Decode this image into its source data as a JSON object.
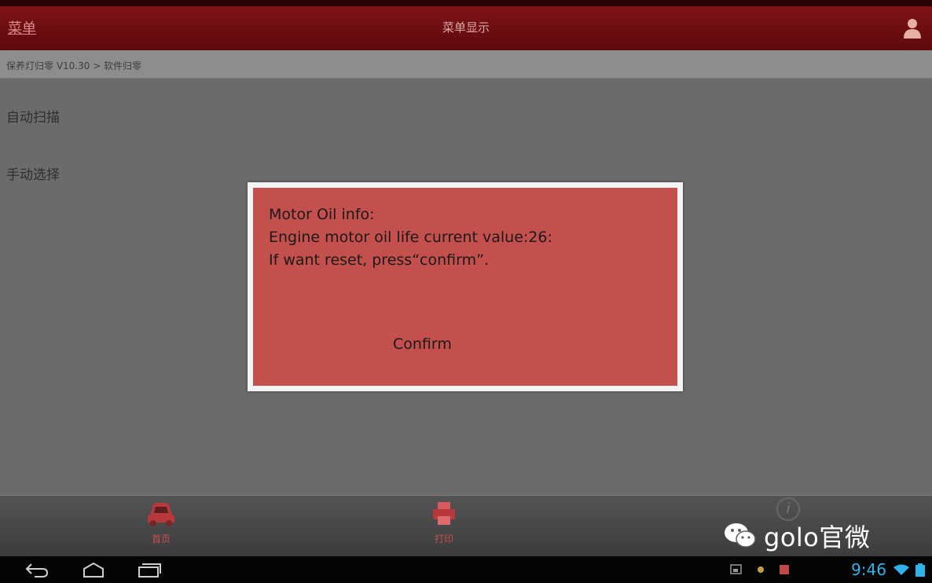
{
  "header": {
    "menu_label": "菜单",
    "title": "菜单显示",
    "user_icon": "user-icon"
  },
  "breadcrumb": "保养灯归零 V10.30 > 软件归零",
  "menu": {
    "items": [
      {
        "label": "自动扫描"
      },
      {
        "label": "手动选择"
      }
    ]
  },
  "dialog": {
    "line1": "Motor Oil info:",
    "line2": "Engine motor oil life current value:26:",
    "line3": "If want reset, press“confirm”.",
    "confirm_label": "Confirm",
    "background": "#c4504e"
  },
  "toolbar": {
    "home_label": "首页",
    "home_icon": "car-icon",
    "print_label": "打印",
    "print_icon": "printer-icon",
    "info_icon": "info-icon"
  },
  "watermark": {
    "text": "golo官微",
    "icon": "wechat-icon"
  },
  "status_bar": {
    "time": "9:46"
  },
  "colors": {
    "brand": "#7e1216",
    "accent_red": "#c85050",
    "clock": "#2fb2e8"
  }
}
